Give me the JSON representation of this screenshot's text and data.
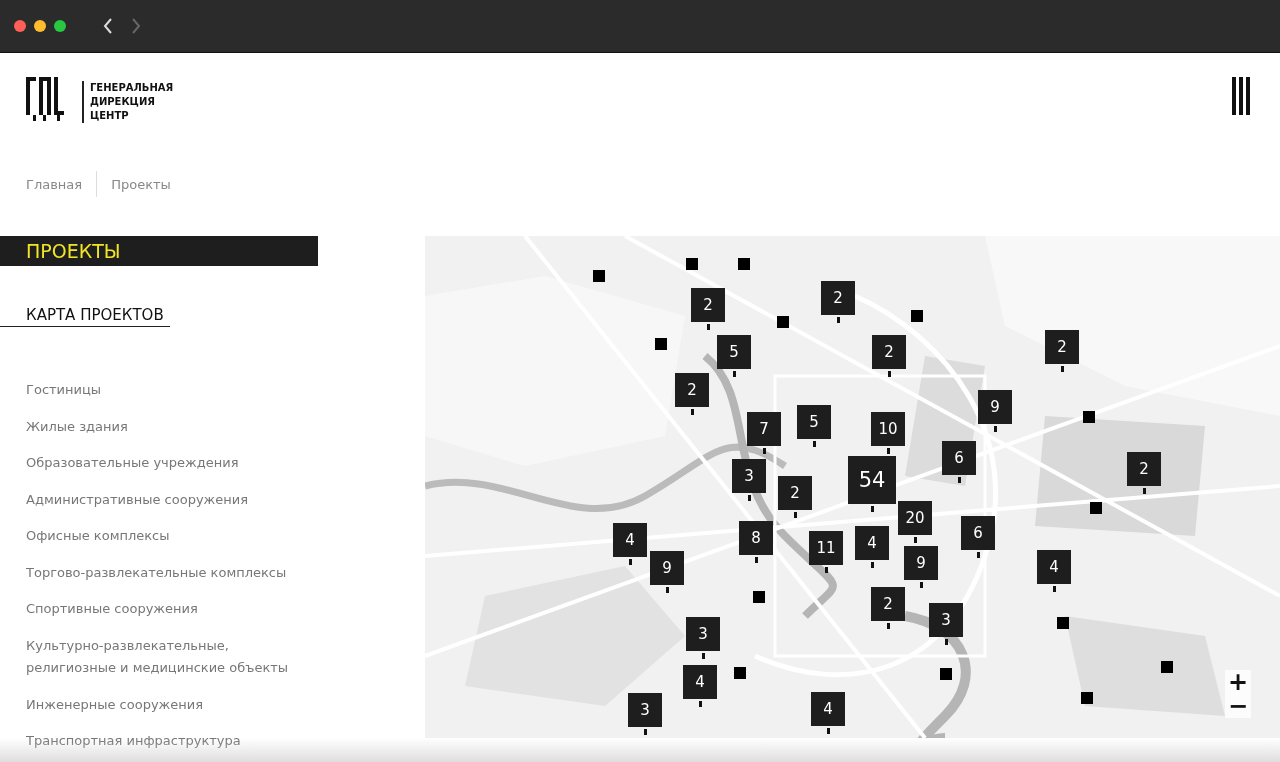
{
  "browser": {
    "back_enabled": true,
    "forward_enabled": false
  },
  "header": {
    "logo_text": [
      "ГЕНЕРАЛЬНАЯ",
      "ДИРЕКЦИЯ",
      "ЦЕНТР"
    ]
  },
  "breadcrumbs": [
    "Главная",
    "Проекты"
  ],
  "sidebar": {
    "title": "ПРОЕКТЫ",
    "subtitle": "КАРТА ПРОЕКТОВ",
    "categories": [
      "Гостиницы",
      "Жилые здания",
      "Образовательные учреждения",
      "Административные сооружения",
      "Офисные комплексы",
      "Торгово-развлекательные комплексы",
      "Спортивные сооружения",
      "Культурно-развлекательные, религиозные и медицинские объекты",
      "Инженерные сооружения",
      "Транспортная инфраструктура"
    ]
  },
  "map": {
    "kind": "picture",
    "markers": [
      {
        "kind": "cluster",
        "count": "2"
      },
      {
        "kind": "cluster",
        "count": "2"
      },
      {
        "kind": "cluster",
        "count": "5"
      },
      {
        "kind": "cluster",
        "count": "2"
      },
      {
        "kind": "cluster",
        "count": "2"
      },
      {
        "kind": "cluster",
        "count": "2"
      },
      {
        "kind": "cluster",
        "count": "9"
      },
      {
        "kind": "cluster",
        "count": "7"
      },
      {
        "kind": "cluster",
        "count": "5"
      },
      {
        "kind": "cluster",
        "count": "10"
      },
      {
        "kind": "cluster",
        "count": "6"
      },
      {
        "kind": "cluster",
        "count": "2"
      },
      {
        "kind": "cluster",
        "count": "3"
      },
      {
        "kind": "cluster",
        "count": "2"
      },
      {
        "kind": "cluster",
        "count": "20"
      },
      {
        "kind": "cluster",
        "count": "54"
      },
      {
        "kind": "cluster",
        "count": "4"
      },
      {
        "kind": "cluster",
        "count": "8"
      },
      {
        "kind": "cluster",
        "count": "11"
      },
      {
        "kind": "cluster",
        "count": "4"
      },
      {
        "kind": "cluster",
        "count": "6"
      },
      {
        "kind": "cluster",
        "count": "9"
      },
      {
        "kind": "cluster",
        "count": "9"
      },
      {
        "kind": "cluster",
        "count": "4"
      },
      {
        "kind": "cluster",
        "count": "2"
      },
      {
        "kind": "cluster",
        "count": "3"
      },
      {
        "kind": "cluster",
        "count": "3"
      },
      {
        "kind": "cluster",
        "count": "4"
      },
      {
        "kind": "cluster",
        "count": "3"
      },
      {
        "kind": "cluster",
        "count": "4"
      },
      {
        "kind": "point"
      },
      {
        "kind": "point"
      },
      {
        "kind": "point"
      },
      {
        "kind": "point"
      },
      {
        "kind": "point"
      },
      {
        "kind": "point"
      },
      {
        "kind": "point"
      },
      {
        "kind": "point"
      },
      {
        "kind": "point"
      },
      {
        "kind": "point"
      },
      {
        "kind": "point"
      },
      {
        "kind": "point"
      },
      {
        "kind": "point"
      },
      {
        "kind": "point"
      }
    ],
    "zoom_in": "+",
    "zoom_out": "−"
  }
}
